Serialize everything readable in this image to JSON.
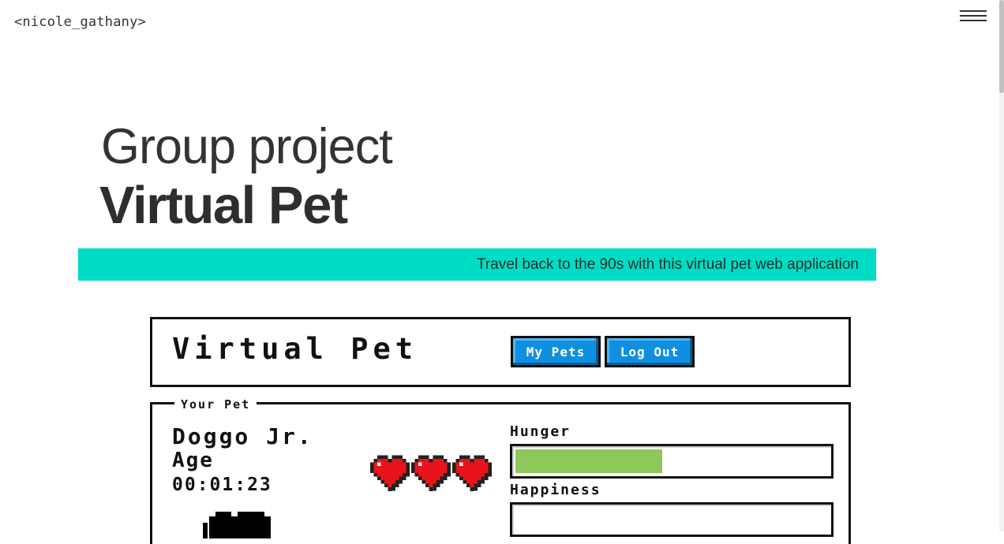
{
  "site": {
    "logo": "<nicole_gathany>",
    "menu_icon": "hamburger-icon"
  },
  "project": {
    "eyebrow": "Group project",
    "title": "Virtual Pet",
    "banner": "Travel back to the 90s with this virtual pet web application",
    "banner_color": "#00ddc4"
  },
  "app": {
    "title": "Virtual Pet",
    "buttons": [
      {
        "label": "My Pets"
      },
      {
        "label": "Log Out"
      }
    ],
    "button_color": "#0f8fe0"
  },
  "pet": {
    "legend": "Your Pet",
    "name": "Doggo Jr.",
    "age_label": "Age",
    "age_value": "00:01:23",
    "lives": 3,
    "heart_icon": "heart-icon",
    "stats": {
      "hunger": {
        "label": "Hunger",
        "level": 0.47,
        "color": "#8cc85a"
      },
      "happiness": {
        "label": "Happiness",
        "level": 0
      }
    }
  }
}
